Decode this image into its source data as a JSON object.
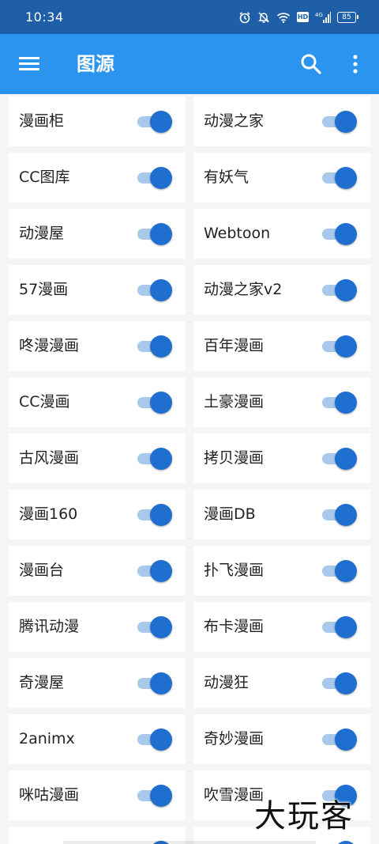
{
  "status_bar": {
    "time": "10:34",
    "network": "4G",
    "hd": "HD",
    "battery": "85"
  },
  "app_bar": {
    "title": "图源"
  },
  "sources": [
    {
      "name": "漫画柜",
      "enabled": true
    },
    {
      "name": "动漫之家",
      "enabled": true
    },
    {
      "name": "CC图库",
      "enabled": true
    },
    {
      "name": "有妖气",
      "enabled": true
    },
    {
      "name": "动漫屋",
      "enabled": true
    },
    {
      "name": "Webtoon",
      "enabled": true
    },
    {
      "name": "57漫画",
      "enabled": true
    },
    {
      "name": "动漫之家v2",
      "enabled": true
    },
    {
      "name": "咚漫漫画",
      "enabled": true
    },
    {
      "name": "百年漫画",
      "enabled": true
    },
    {
      "name": "CC漫画",
      "enabled": true
    },
    {
      "name": "土豪漫画",
      "enabled": true
    },
    {
      "name": "古风漫画",
      "enabled": true
    },
    {
      "name": "拷贝漫画",
      "enabled": true
    },
    {
      "name": "漫画160",
      "enabled": true
    },
    {
      "name": "漫画DB",
      "enabled": true
    },
    {
      "name": "漫画台",
      "enabled": true
    },
    {
      "name": "扑飞漫画",
      "enabled": true
    },
    {
      "name": "腾讯动漫",
      "enabled": true
    },
    {
      "name": "布卡漫画",
      "enabled": true
    },
    {
      "name": "奇漫屋",
      "enabled": true
    },
    {
      "name": "动漫狂",
      "enabled": true
    },
    {
      "name": "2animx",
      "enabled": true
    },
    {
      "name": "奇妙漫画",
      "enabled": true
    },
    {
      "name": "咪咕漫画",
      "enabled": true
    },
    {
      "name": "吹雪漫画",
      "enabled": true
    },
    {
      "name": "",
      "enabled": true
    },
    {
      "name": "",
      "enabled": true
    }
  ],
  "watermark": "大玩客",
  "colors": {
    "status_bar": "#1e5fa8",
    "app_bar": "#2b94ee",
    "toggle_on": "#1f6fd0",
    "toggle_track": "#a9c9ec"
  }
}
